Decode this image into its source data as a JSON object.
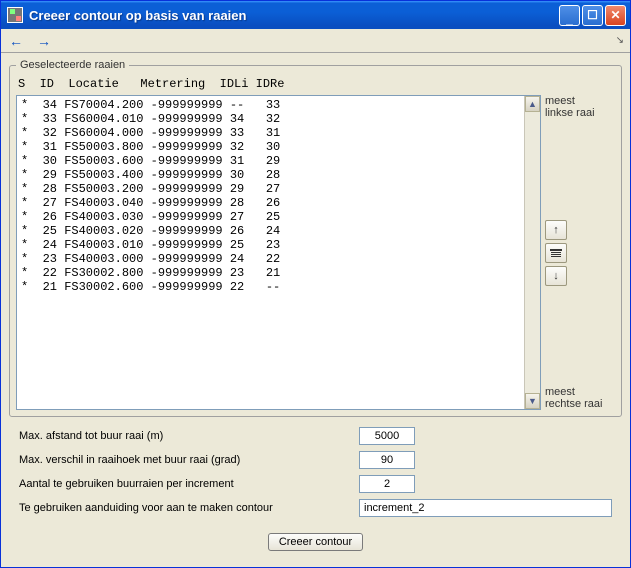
{
  "window": {
    "title": "Creeer contour op basis van raaien"
  },
  "toolbar": {
    "back": "←",
    "forward": "→",
    "grip": "↘"
  },
  "group": {
    "legend": "Geselecteerde raaien",
    "columns": "S  ID  Locatie   Metrering  IDLi IDRe",
    "side_top1": "meest",
    "side_top2": "linkse raai",
    "side_bot1": "meest",
    "side_bot2": "rechtse raai"
  },
  "rows": [
    "*  34 FS70004.200 -999999999 --   33",
    "*  33 FS60004.010 -999999999 34   32",
    "*  32 FS60004.000 -999999999 33   31",
    "*  31 FS50003.800 -999999999 32   30",
    "*  30 FS50003.600 -999999999 31   29",
    "*  29 FS50003.400 -999999999 30   28",
    "*  28 FS50003.200 -999999999 29   27",
    "*  27 FS40003.040 -999999999 28   26",
    "*  26 FS40003.030 -999999999 27   25",
    "*  25 FS40003.020 -999999999 26   24",
    "*  24 FS40003.010 -999999999 25   23",
    "*  23 FS40003.000 -999999999 24   22",
    "*  22 FS30002.800 -999999999 23   21",
    "*  21 FS30002.600 -999999999 22   --"
  ],
  "form": {
    "label_max_dist": "Max. afstand tot buur raai (m)",
    "val_max_dist": "5000",
    "label_max_angle": "Max. verschil in raaihoek met buur raai (grad)",
    "val_max_angle": "90",
    "label_count": "Aantal te gebruiken buurraien per increment",
    "val_count": "2",
    "label_name": "Te gebruiken aanduiding voor aan te maken contour",
    "val_name": "increment_2",
    "action": "Creeer contour"
  }
}
